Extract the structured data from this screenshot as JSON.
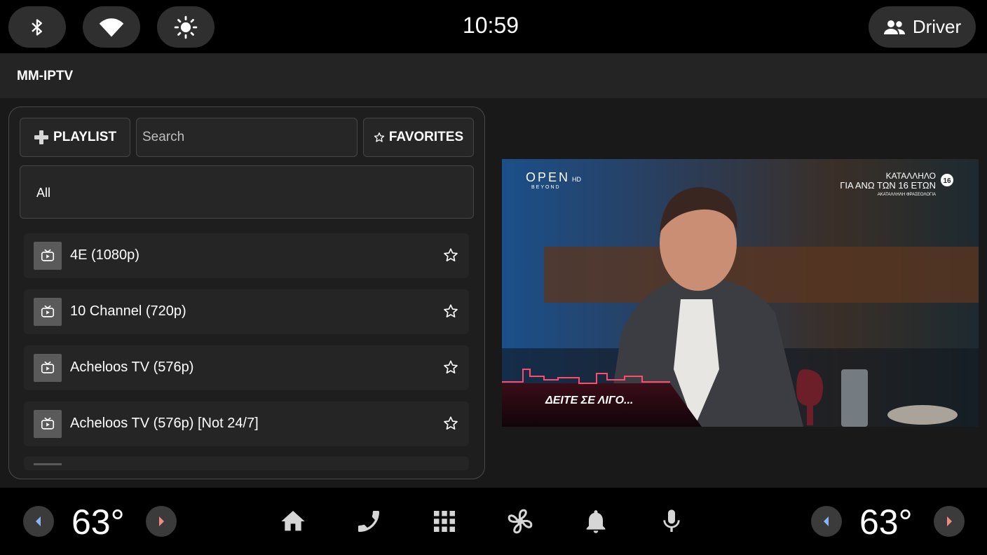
{
  "status_bar": {
    "time": "10:59",
    "profile_label": "Driver",
    "icons": [
      "bluetooth-icon",
      "wifi-icon",
      "brightness-icon",
      "people-icon"
    ]
  },
  "app": {
    "title": "MM-IPTV"
  },
  "toolbar": {
    "playlist_label": "PLAYLIST",
    "search_placeholder": "Search",
    "favorites_label": "FAVORITES"
  },
  "filter": {
    "label": "All"
  },
  "channels": [
    {
      "name": "4E (1080p)",
      "icon": "tv-icon",
      "favorite": false
    },
    {
      "name": "10 Channel (720p)",
      "icon": "tv-icon",
      "favorite": false
    },
    {
      "name": "Acheloos TV (576p)",
      "icon": "tv-icon",
      "favorite": false
    },
    {
      "name": "Acheloos TV (576p) [Not 24/7]",
      "icon": "tv-icon",
      "favorite": false
    }
  ],
  "video": {
    "brand": "OPEN",
    "brand_sub": "BEYOND",
    "brand_hd": "HD",
    "rating_line1": "ΚΑΤΑΛΛΗΛΟ",
    "rating_line2": "ΓΙΑ ΑΝΩ ΤΩΝ 16 ΕΤΩΝ",
    "rating_line3": "ΑΚΑΤΑΛΛΗΛΗ ΦΡΑΣΕΟΛΟΓΙΑ",
    "rating_badge": "16",
    "caption": "ΔΕΙΤΕ ΣΕ ΛΙΓΟ..."
  },
  "nav_bar": {
    "left_temp": "63°",
    "right_temp": "63°",
    "icons": [
      "home-icon",
      "phone-icon",
      "apps-grid-icon",
      "fan-icon",
      "bell-icon",
      "mic-icon"
    ]
  },
  "colors": {
    "accent_blue": "#8ab4f8",
    "accent_red": "#f28b82"
  }
}
